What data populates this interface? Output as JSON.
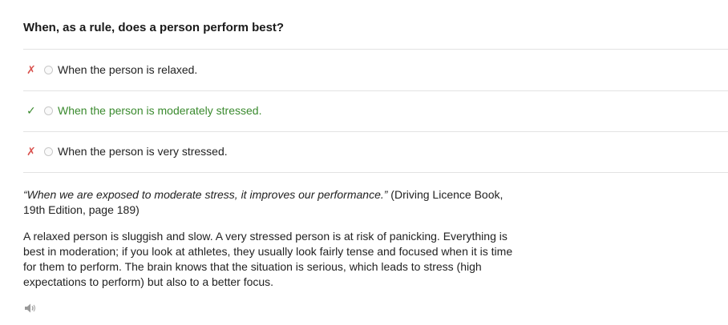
{
  "question": "When, as a rule, does a person perform best?",
  "options": [
    {
      "mark": "✗",
      "label": "When the person is relaxed.",
      "status": "wrong"
    },
    {
      "mark": "✓",
      "label": "When the person is moderately stressed.",
      "status": "correct"
    },
    {
      "mark": "✗",
      "label": "When the person is very stressed.",
      "status": "wrong"
    }
  ],
  "explanation": {
    "quote": "“When we are exposed to moderate stress, it improves our performance.”",
    "source": " (Driving Licence Book, 19th Edition, page 189)",
    "body": "A relaxed person is sluggish and slow. A very stressed person is at risk of panicking. Everything is best in moderation; if you look at athletes, they usually look fairly tense and focused when it is time for them to perform. The brain knows that the situation is serious, which leads to stress (high expectations to perform) but also to a better focus."
  },
  "icons": {
    "audio": "speaker-icon"
  },
  "colors": {
    "correct": "#3a8a2e",
    "wrong": "#d9534f"
  }
}
